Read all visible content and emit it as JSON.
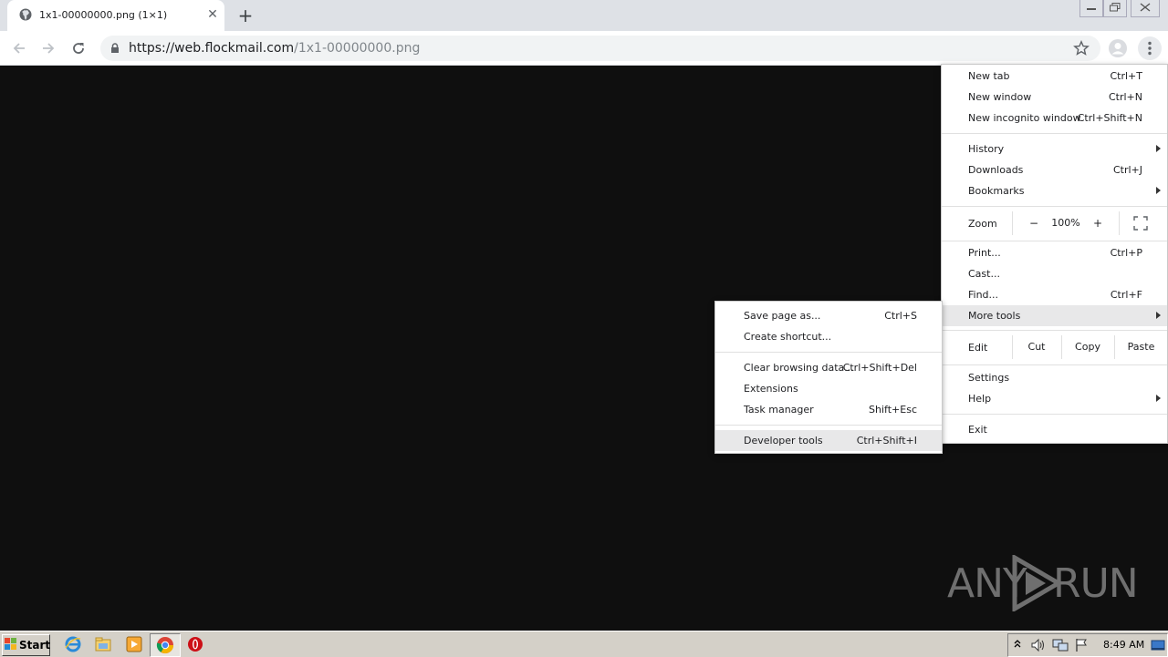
{
  "browser": {
    "tab": {
      "title": "1x1-00000000.png (1×1)",
      "close_glyph": "✕"
    },
    "new_tab_glyph": "+",
    "address": {
      "host": "https://web.flockmail.com",
      "path": "/1x1-00000000.png"
    }
  },
  "menu": {
    "items": [
      {
        "label": "New tab",
        "shortcut": "Ctrl+T"
      },
      {
        "label": "New window",
        "shortcut": "Ctrl+N"
      },
      {
        "label": "New incognito window",
        "shortcut": "Ctrl+Shift+N"
      },
      {
        "label": "History",
        "shortcut": ""
      },
      {
        "label": "Downloads",
        "shortcut": "Ctrl+J"
      },
      {
        "label": "Bookmarks",
        "shortcut": ""
      },
      {
        "label": "Print...",
        "shortcut": "Ctrl+P"
      },
      {
        "label": "Cast...",
        "shortcut": ""
      },
      {
        "label": "Find...",
        "shortcut": "Ctrl+F"
      },
      {
        "label": "More tools",
        "shortcut": ""
      },
      {
        "label": "Settings",
        "shortcut": ""
      },
      {
        "label": "Help",
        "shortcut": ""
      },
      {
        "label": "Exit",
        "shortcut": ""
      }
    ],
    "zoom": {
      "label": "Zoom",
      "minus": "−",
      "value": "100%",
      "plus": "+"
    },
    "edit": {
      "label": "Edit",
      "cut": "Cut",
      "copy": "Copy",
      "paste": "Paste"
    }
  },
  "submenu": {
    "items": [
      {
        "label": "Save page as...",
        "shortcut": "Ctrl+S"
      },
      {
        "label": "Create shortcut...",
        "shortcut": ""
      },
      {
        "label": "Clear browsing data...",
        "shortcut": "Ctrl+Shift+Del"
      },
      {
        "label": "Extensions",
        "shortcut": ""
      },
      {
        "label": "Task manager",
        "shortcut": "Shift+Esc"
      },
      {
        "label": "Developer tools",
        "shortcut": "Ctrl+Shift+I"
      }
    ]
  },
  "watermark": {
    "left": "ANY",
    "right": "RUN"
  },
  "taskbar": {
    "start_label": "Start",
    "clock": "8:49 AM"
  },
  "colors": {
    "page_bg": "#0f0f0f",
    "tabstrip": "#dee1e6",
    "menu_highlight": "#e8e8e9",
    "taskbar": "#d4d0c8"
  }
}
